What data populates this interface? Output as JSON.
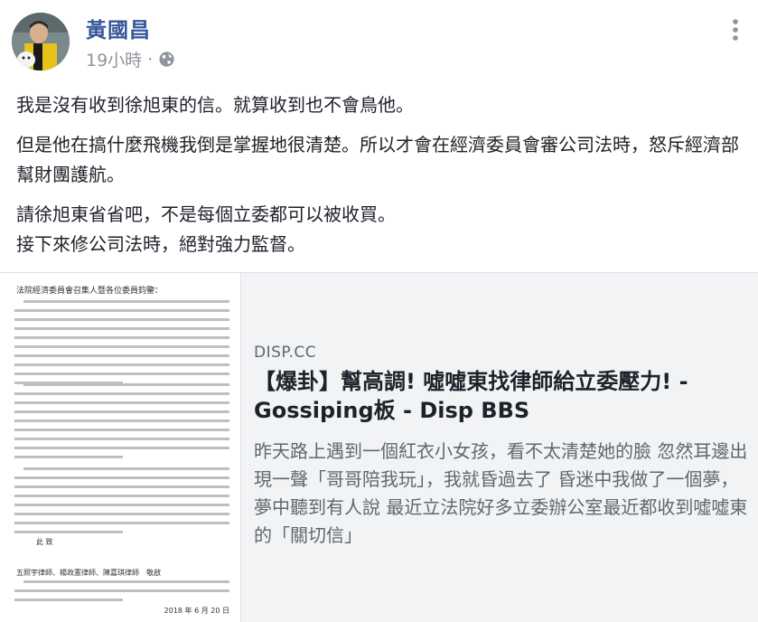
{
  "post": {
    "author": "黃國昌",
    "time": "19小時",
    "separator": "·",
    "paragraphs": [
      "我是沒有收到徐旭東的信。就算收到也不會鳥他。",
      "但是他在搞什麼飛機我倒是掌握地很清楚。所以才會在經濟委員會審公司法時，怒斥經濟部幫財團護航。",
      "請徐旭東省省吧，不是每個立委都可以被收買。\n接下來修公司法時，絕對強力監督。"
    ]
  },
  "link_preview": {
    "domain": "DISP.CC",
    "title": "【爆卦】幫高調! 噓噓東找律師給立委壓力! - Gossiping板 - Disp BBS",
    "description": "昨天路上遇到一個紅衣小女孩，看不太清楚她的臉 忽然耳邊出現一聲「哥哥陪我玩」，我就昏過去了 昏迷中我做了一個夢， 夢中聽到有人說 最近立法院好多立委辦公室最近都收到噓噓東的「關切信」",
    "thumbnail": {
      "letter_heading": "法院經濟委員會召集人暨各位委員鈞鑒：",
      "closing": "此 致",
      "signers": "五照宇律師、楊政憲律師、陳嘉琪律師　敬啟",
      "date": "2018 年 6 月 20 日"
    }
  },
  "icons": {
    "privacy": "globe-icon",
    "menu": "more-vertical-icon"
  },
  "colors": {
    "author": "#365899",
    "meta": "#90949c",
    "text": "#1d2129",
    "card_bg": "#f2f3f5",
    "card_desc": "#606770"
  }
}
